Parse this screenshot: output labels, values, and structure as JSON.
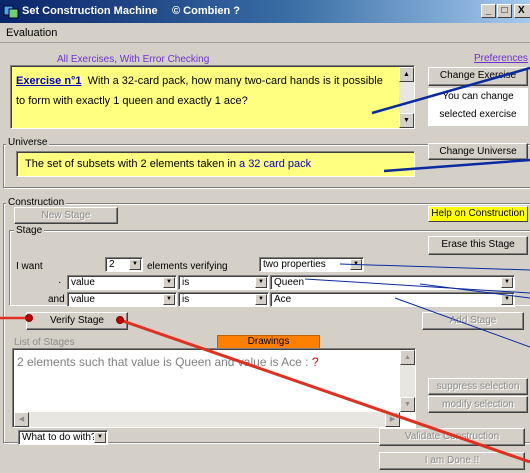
{
  "window": {
    "title": "Set Construction Machine",
    "copyright": "© Combien ?",
    "minimize": "_",
    "maximize": "□",
    "close": "X"
  },
  "menu": {
    "evaluation": "Evaluation"
  },
  "exercise": {
    "mode_link": "All Exercises,  With Error Checking",
    "preferences": "Preferences",
    "number": "Exercise n°1",
    "question": "With a 32-card pack, how many two-card hands is it possible to form with exactly 1 queen and exactly 1 ace?",
    "change_button": "Change Exercise",
    "change_hint": "You can change selected exercise"
  },
  "universe": {
    "label": "Universe",
    "text_prefix": "The set of subsets with 2 elements taken in ",
    "text_link": "a 32 card pack",
    "change_button": "Change Universe"
  },
  "construction": {
    "label": "Construction",
    "new_stage": "New Stage",
    "help": "Help on Construction",
    "stage_label": "Stage",
    "erase_stage": "Erase this Stage",
    "i_want": "I want",
    "count": "2",
    "elements_verifying": "elements verifying",
    "properties": "two properties",
    "row1": {
      "prefix": "·",
      "attr": "value",
      "op": "is",
      "val": "Queen"
    },
    "row2": {
      "prefix": "and",
      "attr": "value",
      "op": "is",
      "val": "Ace"
    },
    "verify_stage": "Verify Stage",
    "add_stage": "Add Stage",
    "drawings": "Drawings",
    "list_label": "List of Stages",
    "list_item": "2 elements such that value is Queen and value is Ace : ",
    "list_item_flag": "?",
    "suppress": "suppress  selection",
    "modify": "modify selection",
    "what_to_do": "What to do with?",
    "validate": "Validate Construction",
    "done": "I am Done !!"
  },
  "colors": {
    "accent_yellow": "#ffff80",
    "help_yellow": "#ffff00",
    "drawings_orange": "#ff8000",
    "arrow_red": "#e03020",
    "arrow_blue": "#0a2aa0"
  }
}
